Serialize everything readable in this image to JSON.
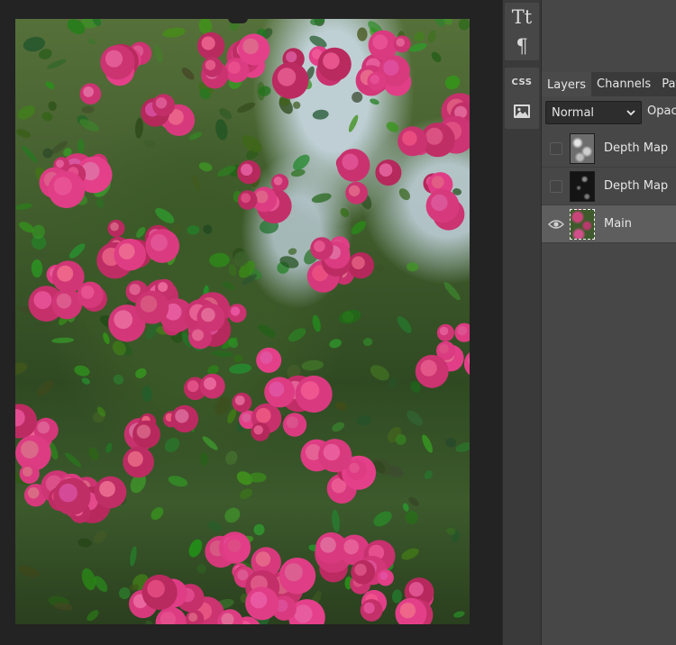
{
  "tools": {
    "text_glyph": "Tt",
    "paragraph_glyph": "¶",
    "css_label": "CSS",
    "image_icon": "image-icon"
  },
  "canvas": {
    "image_description_icon": "photo-canvas"
  },
  "panel": {
    "tabs": [
      {
        "label": "Layers",
        "active": true
      },
      {
        "label": "Channels",
        "active": false
      },
      {
        "label": "Paths",
        "active": false
      }
    ],
    "blend_mode": "Normal",
    "opacity_label": "Opacity:",
    "layers": [
      {
        "name": "Depth Map",
        "visible": false,
        "thumb": "depth1",
        "selected": false
      },
      {
        "name": "Depth Map",
        "visible": false,
        "thumb": "depth2",
        "selected": false
      },
      {
        "name": "Main",
        "visible": true,
        "thumb": "main",
        "selected": true
      }
    ]
  },
  "colors": {
    "canvas_bg": "#232323",
    "panel_bg": "#474747",
    "tab_strip_bg": "#3a3a3a",
    "selected_layer_bg": "#5e5e5e",
    "rose_pink": "#c8457a"
  }
}
